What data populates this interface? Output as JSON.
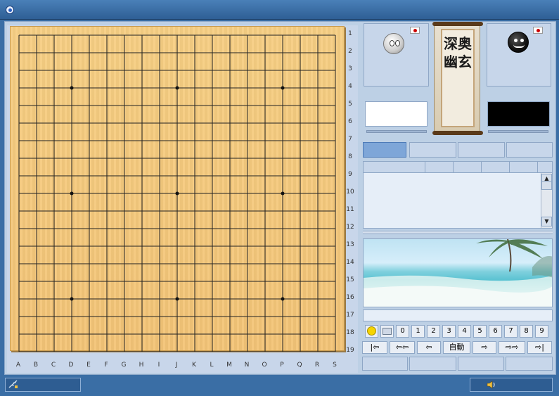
{
  "board": {
    "size": 19,
    "row_labels": [
      "1",
      "2",
      "3",
      "4",
      "5",
      "6",
      "7",
      "8",
      "9",
      "10",
      "11",
      "12",
      "13",
      "14",
      "15",
      "16",
      "17",
      "18",
      "19"
    ],
    "col_labels": [
      "A",
      "B",
      "C",
      "D",
      "E",
      "F",
      "G",
      "H",
      "I",
      "J",
      "K",
      "L",
      "M",
      "N",
      "O",
      "P",
      "Q",
      "R",
      "S"
    ],
    "star_points": [
      [
        "D",
        "4"
      ],
      [
        "J",
        "4"
      ],
      [
        "P",
        "4"
      ],
      [
        "D",
        "10"
      ],
      [
        "J",
        "10"
      ],
      [
        "P",
        "10"
      ],
      [
        "D",
        "16"
      ],
      [
        "J",
        "16"
      ],
      [
        "P",
        "16"
      ]
    ],
    "stones": []
  },
  "players": {
    "white": {
      "flag": "japan-flag",
      "avatar": "white-stone-face-icon"
    },
    "black": {
      "flag": "japan-flag",
      "avatar": "black-stone-face-icon"
    }
  },
  "scroll": {
    "text": "深奥幽玄"
  },
  "numbers": [
    "0",
    "1",
    "2",
    "3",
    "4",
    "5",
    "6",
    "7",
    "8",
    "9"
  ],
  "nav": {
    "first": "|⇦",
    "back_fast": "⇦⇦",
    "back": "⇦",
    "auto": "自動",
    "forward": "⇨",
    "forward_fast": "⇨⇨",
    "last": "⇨|"
  },
  "colors": {
    "board": "#f3c477",
    "frame": "#3a6ea5",
    "panel": "#c7d6ea",
    "active_tab": "#7ea6d8"
  }
}
